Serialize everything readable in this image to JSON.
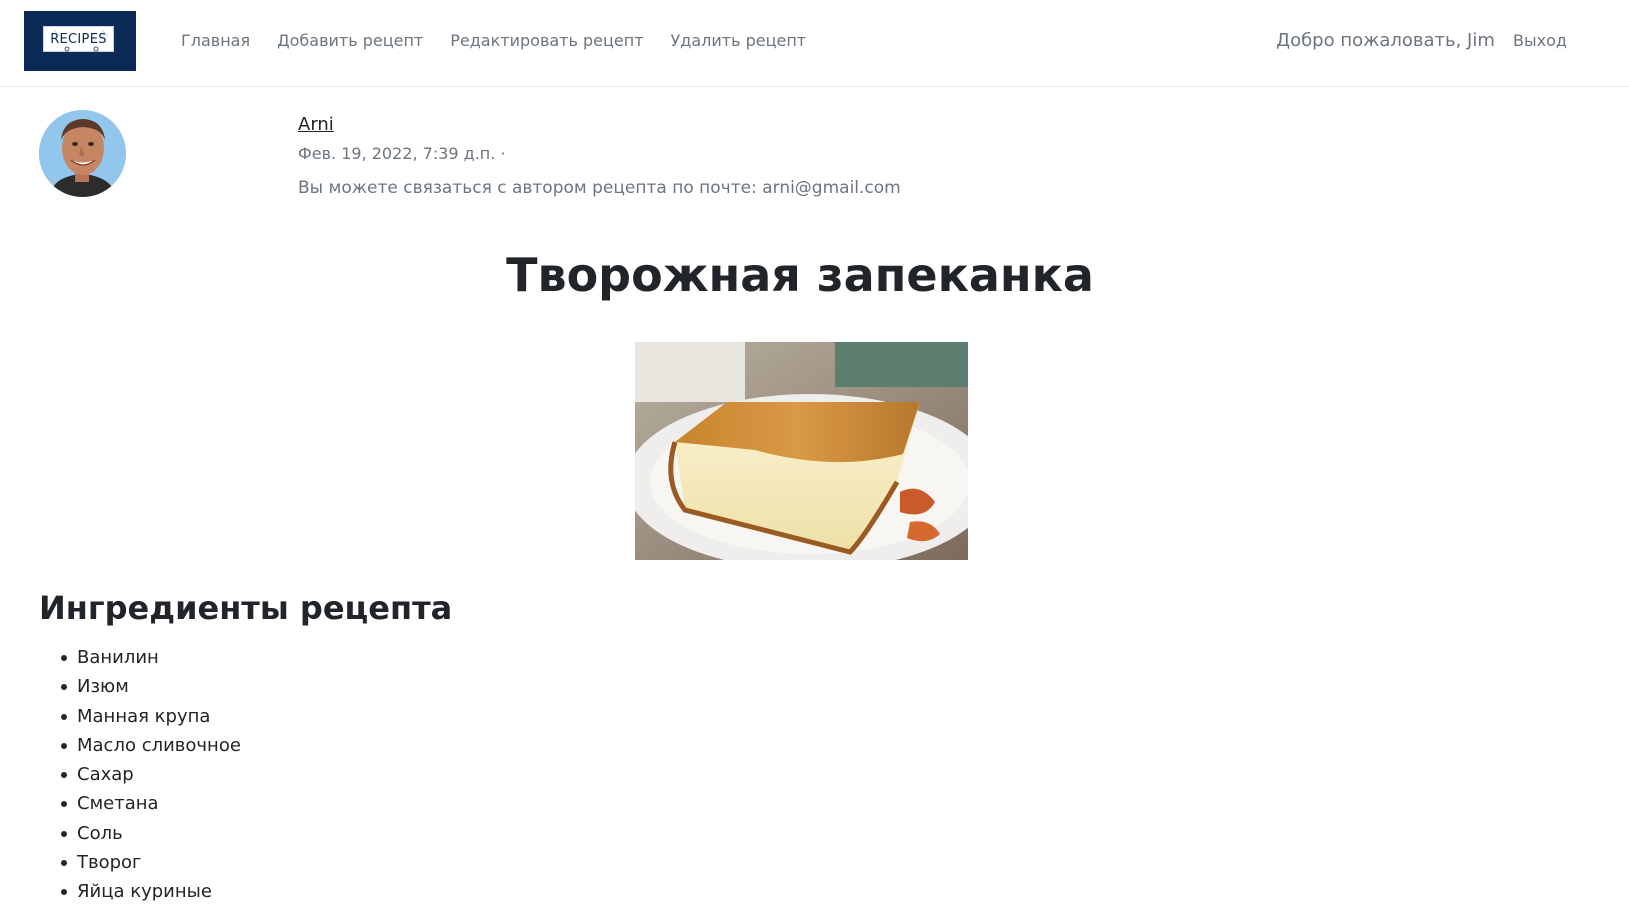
{
  "navbar": {
    "brand": "RECIPES",
    "links": [
      {
        "label": "Главная"
      },
      {
        "label": "Добавить рецепт"
      },
      {
        "label": "Редактировать рецепт"
      },
      {
        "label": "Удалить рецепт"
      }
    ],
    "welcome": "Добро пожаловать, Jim",
    "logout": "Выход"
  },
  "author": {
    "name": "Arni",
    "date": "Фев. 19, 2022, 7:39 д.п. ·",
    "contact": "Вы можете связаться с автором рецепта по почте: arni@gmail.com"
  },
  "recipe": {
    "title": "Творожная запеканка",
    "ingredients_heading": "Ингредиенты рецепта",
    "ingredients": [
      "Ванилин",
      "Изюм",
      "Манная крупа",
      "Масло сливочное",
      "Сахар",
      "Сметана",
      "Соль",
      "Творог",
      "Яйца куриные"
    ]
  },
  "colors": {
    "brand_bg": "#0b2a55",
    "muted_text": "#6c757d",
    "body_text": "#212529"
  }
}
